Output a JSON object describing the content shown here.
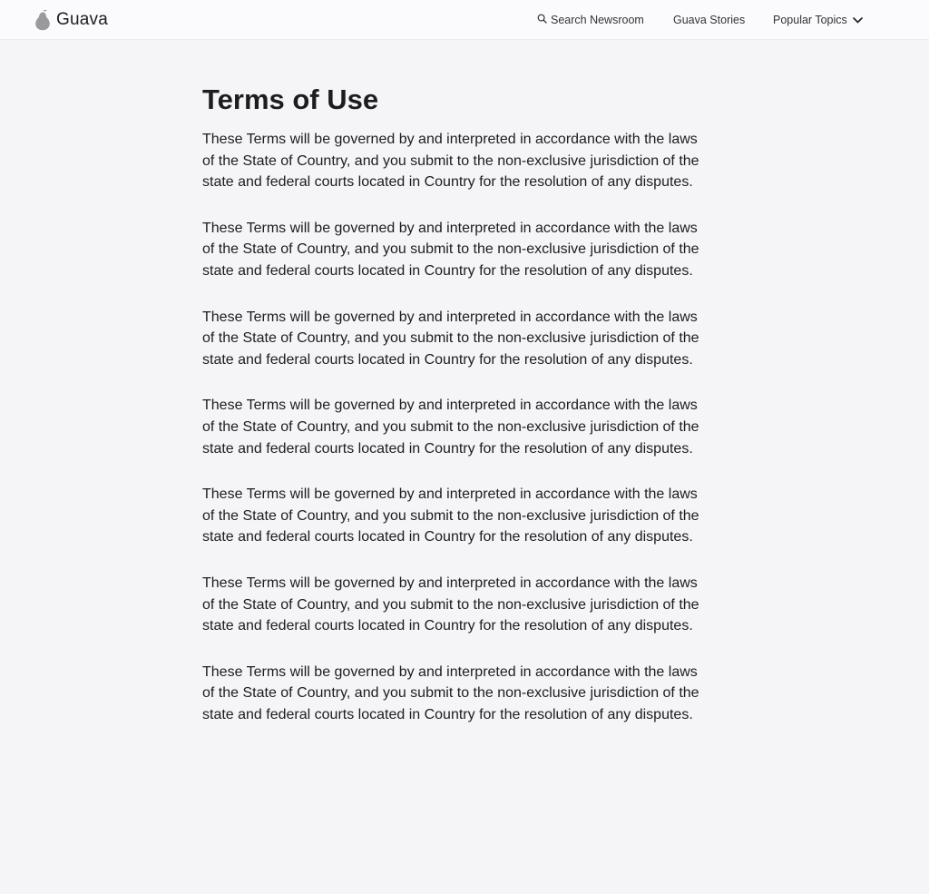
{
  "header": {
    "brand_name": "Guava",
    "nav": {
      "search_label": "Search Newsroom",
      "stories_label": "Guava Stories",
      "topics_label": "Popular Topics"
    }
  },
  "page": {
    "title": "Terms of Use",
    "paragraphs": [
      "These Terms will be governed by and interpreted in accordance with the laws of the State of Country, and you submit to the non-exclusive jurisdiction of the state and federal courts located in Country for the resolution of any disputes.",
      "These Terms will be governed by and interpreted in accordance with the laws of the State of Country, and you submit to the non-exclusive jurisdiction of the state and federal courts located in Country for the resolution of any disputes.",
      "These Terms will be governed by and interpreted in accordance with the laws of the State of Country, and you submit to the non-exclusive jurisdiction of the state and federal courts located in Country for the resolution of any disputes.",
      "These Terms will be governed by and interpreted in accordance with the laws of the State of Country, and you submit to the non-exclusive jurisdiction of the state and federal courts located in Country for the resolution of any disputes.",
      "These Terms will be governed by and interpreted in accordance with the laws of the State of Country, and you submit to the non-exclusive jurisdiction of the state and federal courts located in Country for the resolution of any disputes.",
      "These Terms will be governed by and interpreted in accordance with the laws of the State of Country, and you submit to the non-exclusive jurisdiction of the state and federal courts located in Country for the resolution of any disputes.",
      "These Terms will be governed by and interpreted in accordance with the laws of the State of Country, and you submit to the non-exclusive jurisdiction of the state and federal courts located in Country for the resolution of any disputes."
    ]
  },
  "icons": {
    "logo": "guava-fruit-icon",
    "search": "search-icon",
    "chevron": "chevron-down-icon"
  },
  "colors": {
    "page_background": "#f5f5f7",
    "header_background": "#fbfbfd",
    "text": "#1d1d1f",
    "logo_fill": "#9a9a9e"
  }
}
